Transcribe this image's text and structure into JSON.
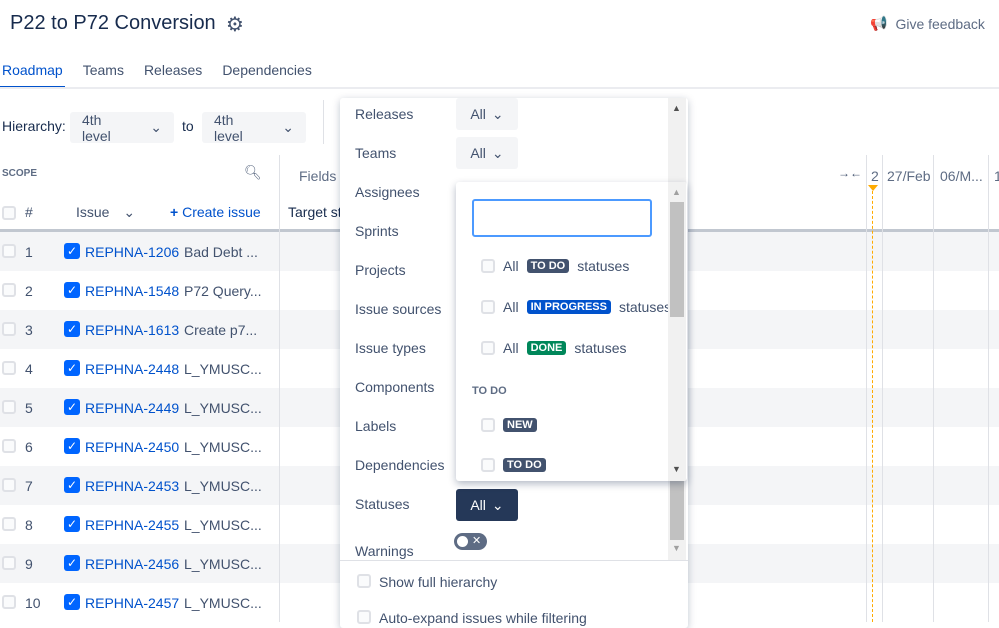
{
  "header": {
    "title": "P22 to P72 Conversion",
    "feedback": "Give feedback"
  },
  "tabs": [
    "Roadmap",
    "Teams",
    "Releases",
    "Dependencies"
  ],
  "hierarchy": {
    "label": "Hierarchy:",
    "from": "4th level",
    "to_label": "to",
    "to": "4th level"
  },
  "scope": {
    "label": "SCOPE",
    "fields": "Fields",
    "hash": "#",
    "issue": "Issue",
    "create": "Create issue",
    "target": "Target st"
  },
  "timeline": {
    "cols": [
      "2",
      "27/Feb",
      "06/M...",
      "1"
    ]
  },
  "rows": [
    {
      "n": "1",
      "key": "REPHNA-1206",
      "sum": "Bad Debt ..."
    },
    {
      "n": "2",
      "key": "REPHNA-1548",
      "sum": "P72 Query..."
    },
    {
      "n": "3",
      "key": "REPHNA-1613",
      "sum": "Create p7..."
    },
    {
      "n": "4",
      "key": "REPHNA-2448",
      "sum": "L_YMUSC..."
    },
    {
      "n": "5",
      "key": "REPHNA-2449",
      "sum": "L_YMUSC..."
    },
    {
      "n": "6",
      "key": "REPHNA-2450",
      "sum": "L_YMUSC..."
    },
    {
      "n": "7",
      "key": "REPHNA-2453",
      "sum": "L_YMUSC..."
    },
    {
      "n": "8",
      "key": "REPHNA-2455",
      "sum": "L_YMUSC..."
    },
    {
      "n": "9",
      "key": "REPHNA-2456",
      "sum": "L_YMUSC..."
    },
    {
      "n": "10",
      "key": "REPHNA-2457",
      "sum": "L_YMUSC..."
    }
  ],
  "filters": {
    "labels": [
      "Releases",
      "Teams",
      "Assignees",
      "Sprints",
      "Projects",
      "Issue sources",
      "Issue types",
      "Components",
      "Labels",
      "Dependencies",
      "Statuses",
      "Warnings"
    ],
    "all": "All",
    "show_full": "Show full hierarchy",
    "auto_expand": "Auto-expand issues while filtering"
  },
  "status_dropdown": {
    "search_value": "",
    "all": "All",
    "statuses": "statuses",
    "lozenges": {
      "todo": "TO DO",
      "inprogress": "IN PROGRESS",
      "done": "DONE",
      "new": "NEW"
    },
    "group": "TO DO",
    "colors": {
      "todo": "#42526e",
      "inprogress": "#0052cc",
      "done": "#00875a"
    }
  }
}
